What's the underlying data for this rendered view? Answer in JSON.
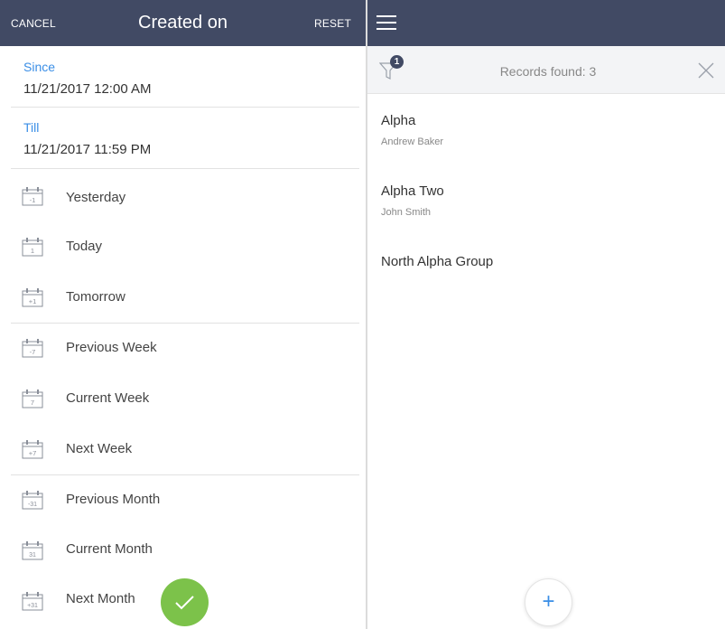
{
  "filter_panel": {
    "cancel_label": "CANCEL",
    "title": "Created on",
    "reset_label": "RESET",
    "since": {
      "label": "Since",
      "value": "11/21/2017 12:00 AM"
    },
    "till": {
      "label": "Till",
      "value": "11/21/2017 11:59 PM"
    },
    "periods": [
      {
        "label": "Yesterday",
        "icon_text": "-1"
      },
      {
        "label": "Today",
        "icon_text": "1"
      },
      {
        "label": "Tomorrow",
        "icon_text": "+1"
      },
      {
        "label": "Previous Week",
        "icon_text": "-7"
      },
      {
        "label": "Current Week",
        "icon_text": "7"
      },
      {
        "label": "Next Week",
        "icon_text": "+7"
      },
      {
        "label": "Previous Month",
        "icon_text": "-31"
      },
      {
        "label": "Current Month",
        "icon_text": "31"
      },
      {
        "label": "Next Month",
        "icon_text": "+31"
      }
    ],
    "ok_icon": "checkmark-icon"
  },
  "list_panel": {
    "menu_icon": "hamburger-icon",
    "filter_badge": "1",
    "records_found": "Records found: 3",
    "close_icon": "close-icon",
    "records": [
      {
        "name": "Alpha",
        "owner": "Andrew Baker"
      },
      {
        "name": "Alpha Two",
        "owner": "John Smith"
      },
      {
        "name": "North Alpha Group",
        "owner": ""
      }
    ],
    "add_symbol": "+"
  },
  "colors": {
    "header_bg": "#414a64",
    "accent_blue": "#3a8ee6",
    "ok_green": "#7cc24a",
    "filter_bar_bg": "#f3f4f6"
  }
}
